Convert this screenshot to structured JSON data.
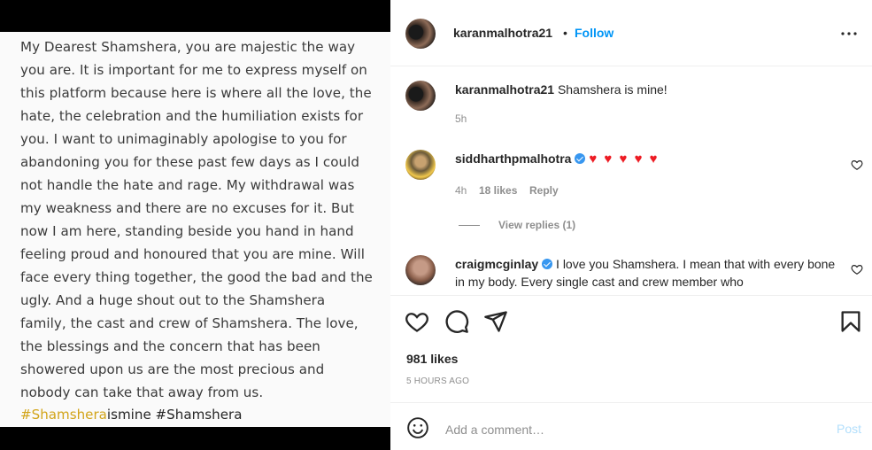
{
  "caption_image": {
    "body": "My Dearest Shamshera, you are majestic the way you are. It is important for me to express myself on this platform because here is where all the love, the hate, the celebration and the humiliation exists for you. I want to unimaginably apologise to you for abandoning you for these past few days as I could not handle the hate and rage. My withdrawal was my weakness and there are no excuses for it. But now I am here, standing beside you hand in hand feeling proud and honoured that you are mine. Will face every thing together, the good the bad and the ugly. And a huge shout out to the Shamshera family, the cast and crew of Shamshera. The love, the blessings and the concern that has been showered upon us are the most precious and nobody can take that away from us.",
    "tag_gold": "#Shamshera",
    "tag_rest": "ismine #Shamshera"
  },
  "header": {
    "username": "karanmalhotra21",
    "separator": "•",
    "follow_label": "Follow"
  },
  "comments": [
    {
      "username": "karanmalhotra21",
      "text": "Shamshera is mine!",
      "time": "5h"
    },
    {
      "username": "siddharthpmalhotra",
      "verified": true,
      "text": "♥ ♥ ♥ ♥ ♥",
      "time": "4h",
      "likes": "18 likes",
      "reply_label": "Reply",
      "view_replies": "View replies (1)"
    },
    {
      "username": "craigmcginlay",
      "verified": true,
      "text": "I love you Shamshera. I mean that with every bone in my body. Every single cast and crew member who"
    }
  ],
  "post": {
    "likes": "981 likes",
    "time": "5 HOURS AGO"
  },
  "add_comment": {
    "placeholder": "Add a comment…",
    "post_label": "Post"
  },
  "colors": {
    "link_blue": "#0095f6",
    "heart_red": "#ed1c24",
    "hashtag_gold": "#d2a419"
  }
}
